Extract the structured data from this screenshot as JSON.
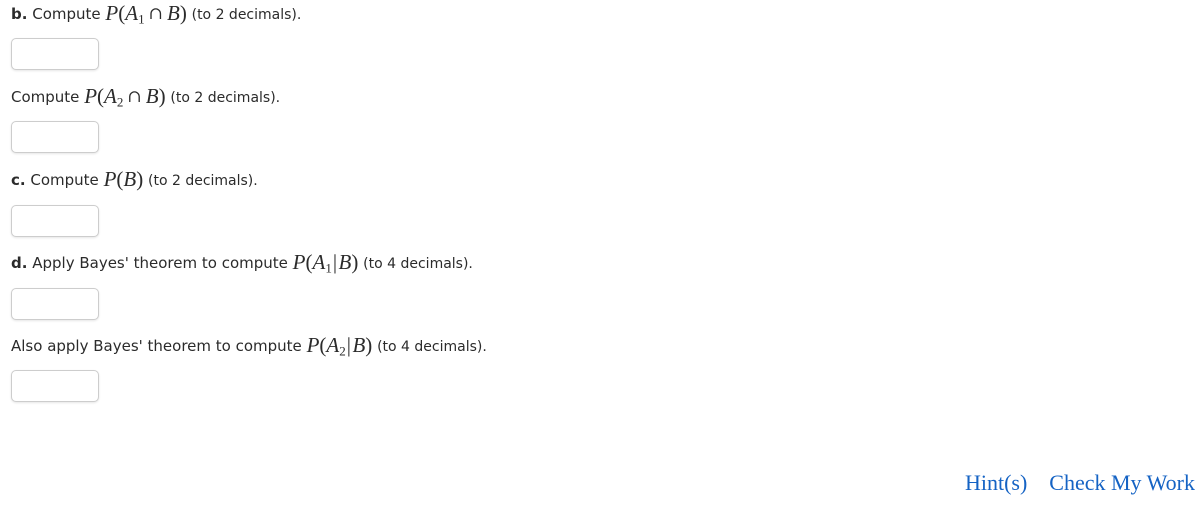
{
  "background_color": "#ffffff",
  "text_color": "#2b2b2b",
  "link_color": "#1563c4",
  "input_border_color": "#cdcdcd",
  "questions": [
    {
      "id": "b",
      "label": "b.",
      "lead": "Compute",
      "math": "P(A1 ∩ B)",
      "math_parts": {
        "p": "P",
        "open": "(",
        "var": "A",
        "sub": "1",
        "op": "∩",
        "var2": "B",
        "close": ")"
      },
      "tail": "(to 2 decimals).",
      "input_value": "",
      "input_placeholder": ""
    },
    {
      "id": "b2",
      "label": "",
      "lead": "Compute",
      "math": "P(A2 ∩ B)",
      "math_parts": {
        "p": "P",
        "open": "(",
        "var": "A",
        "sub": "2",
        "op": "∩",
        "var2": "B",
        "close": ")"
      },
      "tail": "(to 2 decimals).",
      "input_value": "",
      "input_placeholder": ""
    },
    {
      "id": "c",
      "label": "c.",
      "lead": "Compute",
      "math": "P(B)",
      "math_parts": {
        "p": "P",
        "open": "(",
        "var": "B",
        "sub": "",
        "op": "",
        "var2": "",
        "close": ")"
      },
      "tail": "(to 2 decimals).",
      "input_value": "",
      "input_placeholder": ""
    },
    {
      "id": "d",
      "label": "d.",
      "lead": "Apply Bayes' theorem to compute",
      "math": "P(A1|B)",
      "math_parts": {
        "p": "P",
        "open": "(",
        "var": "A",
        "sub": "1",
        "op": "|",
        "var2": "B",
        "close": ")"
      },
      "tail": "(to 4 decimals).",
      "input_value": "",
      "input_placeholder": ""
    },
    {
      "id": "d2",
      "label": "",
      "lead": "Also apply Bayes' theorem to compute",
      "math": "P(A2|B)",
      "math_parts": {
        "p": "P",
        "open": "(",
        "var": "A",
        "sub": "2",
        "op": "|",
        "var2": "B",
        "close": ")"
      },
      "tail": "(to 4 decimals).",
      "input_value": "",
      "input_placeholder": ""
    }
  ],
  "footer": {
    "hint_label": "Hint(s)",
    "check_label": "Check My Work"
  }
}
